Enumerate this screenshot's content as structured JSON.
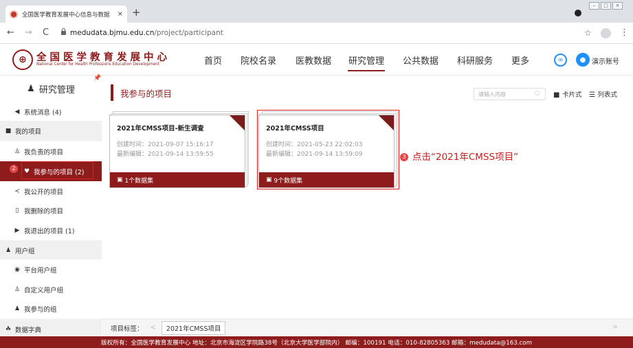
{
  "browser": {
    "tab_title": "全国医学教育发展中心信息与数据",
    "tab_close": "×",
    "new_tab": "+",
    "url_host": "medudata.bjmu.edu.cn",
    "url_path": "/project/participant",
    "back_icon": "←",
    "forward_icon": "→",
    "reload_icon": "C",
    "star_icon": "☆",
    "menu_icon": "⋮"
  },
  "site": {
    "logo_cn": "全国医学教育发展中心",
    "logo_en": "National Center for Health Professions Education Development",
    "nav": [
      "首页",
      "院校名录",
      "医教数据",
      "研究管理",
      "公共数据",
      "科研服务",
      "更多"
    ],
    "active_nav": "研究管理",
    "user_name": "演示账号"
  },
  "sidebar": {
    "title": "研究管理",
    "items": [
      {
        "label": "系统消息 (4)",
        "icon": "speaker-icon",
        "glyph": "◀",
        "type": "child"
      },
      {
        "label": "我的项目",
        "icon": "grid-icon",
        "glyph": "■",
        "type": "group"
      },
      {
        "label": "我负责的项目",
        "icon": "person-icon",
        "glyph": "♙",
        "type": "child"
      },
      {
        "label": "我参与的项目 (2)",
        "icon": "heart-icon",
        "glyph": "♥",
        "type": "child",
        "active": true
      },
      {
        "label": "我公开的项目",
        "icon": "share-icon",
        "glyph": "≺",
        "type": "child"
      },
      {
        "label": "我删除的项目",
        "icon": "trash-icon",
        "glyph": "▯",
        "type": "child"
      },
      {
        "label": "我退出的项目 (1)",
        "icon": "exit-icon",
        "glyph": "▶",
        "type": "child"
      },
      {
        "label": "用户组",
        "icon": "users-icon",
        "glyph": "♟",
        "type": "group"
      },
      {
        "label": "平台用户组",
        "icon": "circle-user-icon",
        "glyph": "◉",
        "type": "child"
      },
      {
        "label": "自定义用户组",
        "icon": "user-edit-icon",
        "glyph": "♙",
        "type": "child"
      },
      {
        "label": "我参与的组",
        "icon": "person-icon",
        "glyph": "♟",
        "type": "child"
      },
      {
        "label": "数据字典",
        "icon": "dictionary-icon",
        "glyph": "☘",
        "type": "group"
      }
    ],
    "step_badge": "2"
  },
  "main": {
    "title": "我参与的项目",
    "search_placeholder": "请输入内容",
    "search_icon": "○",
    "card_view": "卡片式",
    "list_view": "列表式",
    "cards": [
      {
        "title": "2021年CMSS项目-新生调查",
        "created": "创建时间：2021-09-07 15:16:17",
        "edited": "最新编辑：2021-09-14 13:59:55",
        "datasets": "1个数据集"
      },
      {
        "title": "2021年CMSS项目",
        "created": "创建时间：2021-05-23 22:02:03",
        "edited": "最新编辑：2021-09-14 13:59:09",
        "datasets": "9个数据集"
      }
    ],
    "step3_badge": "3",
    "step3_text": "点击“2021年CMSS项目”",
    "tag_label": "项目标签：",
    "tag_prev": "<",
    "tag_chip": "2021年CMSS项目",
    "tag_next": ">"
  },
  "footer": {
    "text": "版权所有：全国医学教育发展中心 地址：北京市海淀区学院路38号（北京大学医学部院内） 邮编：100191 电话：010-82805363 邮箱：medudata@163.com"
  },
  "colors": {
    "brand": "#8e1c1c",
    "highlight": "#e02020",
    "link_blue": "#1e90ff"
  }
}
